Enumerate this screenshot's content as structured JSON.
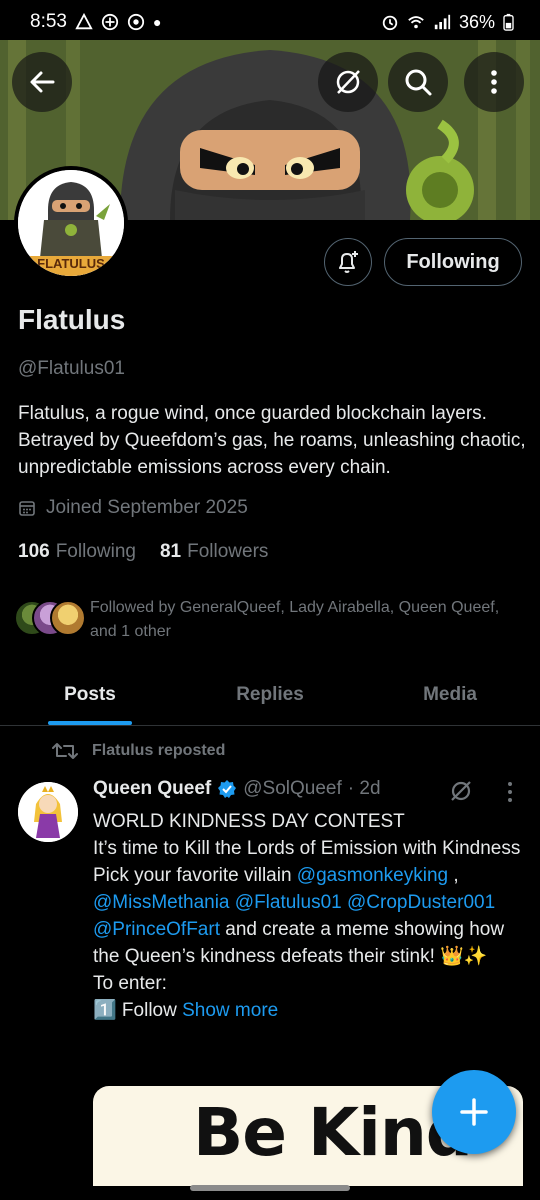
{
  "status_bar": {
    "time": "8:53",
    "battery": "36%"
  },
  "profile": {
    "display_name": "Flatulus",
    "handle": "@Flatulus01",
    "bio": "Flatulus, a rogue wind, once guarded blockchain layers. Betrayed by Queefdom’s gas, he roams, unleashing chaotic, unpredictable emissions across every chain.",
    "joined": "Joined September 2025",
    "following_count": "106",
    "following_label": "Following",
    "followers_count": "81",
    "followers_label": "Followers",
    "followed_by": "Followed by GeneralQueef, Lady Airabella, Queen Queef, and 1 other",
    "follow_button": "Following",
    "avatar_banner_text": "FLATULUS"
  },
  "tabs": [
    {
      "label": "Posts",
      "active": true
    },
    {
      "label": "Replies",
      "active": false
    },
    {
      "label": "Media",
      "active": false
    }
  ],
  "post": {
    "repost_label": "Flatulus reposted",
    "author_name": "Queen Queef",
    "author_handle": "@SolQueef",
    "time": "· 2d",
    "line1": "WORLD KINDNESS DAY CONTEST",
    "line2": "It’s time to Kill the Lords of Emission with Kindness",
    "line3_prefix": "Pick your favorite villain ",
    "mention1": "@gasmonkeyking",
    "line3_sep": " ,",
    "mention2": "@MissMethania",
    "mention3": "@Flatulus01",
    "mention4": "@CropDuster001",
    "mention5": "@PrinceOfFart",
    "line3_suffix": " and create a meme showing how the Queen’s kindness defeats their stink! 👑✨",
    "line4": "To enter:",
    "line5_prefix": "1️⃣ Follow ",
    "show_more": "Show more",
    "media_text": "Be Kind"
  },
  "colors": {
    "accent": "#1d9bf0",
    "muted": "#71767b",
    "text": "#e7e9ea",
    "border": "#2f3336"
  },
  "icons": [
    "back-arrow-icon",
    "grok-icon",
    "search-icon",
    "more-vertical-icon",
    "bell-plus-icon",
    "calendar-icon",
    "repost-icon",
    "verified-badge-icon",
    "plus-icon"
  ]
}
